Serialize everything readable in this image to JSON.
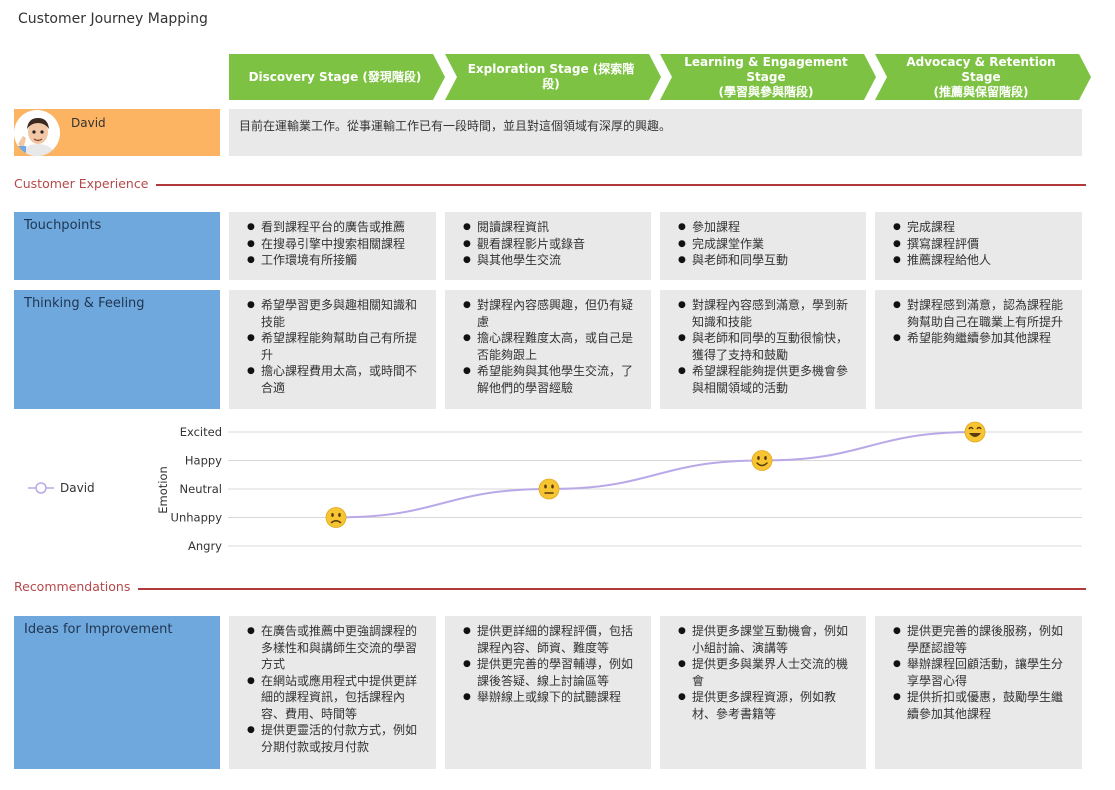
{
  "title": "Customer Journey Mapping",
  "stages": [
    {
      "line1": "Discovery Stage (發現階段)",
      "line2": ""
    },
    {
      "line1": "Exploration Stage (探索階段)",
      "line2": ""
    },
    {
      "line1": "Learning & Engagement Stage",
      "line2": "(學習與參與階段)"
    },
    {
      "line1": "Advocacy & Retention Stage",
      "line2": "(推薦與保留階段)"
    }
  ],
  "persona": {
    "name": "David",
    "description": "目前在運輸業工作。從事運輸工作已有一段時間，並且對這個領域有深厚的興趣。"
  },
  "sections": {
    "experience": "Customer Experience",
    "recommendations": "Recommendations"
  },
  "rows": {
    "touchpoints": {
      "label": "Touchpoints",
      "cells": [
        [
          "看到課程平台的廣告或推薦",
          "在搜尋引擎中搜索相關課程",
          "工作環境有所接觸"
        ],
        [
          "閱讀課程資訊",
          "觀看課程影片或錄音",
          "與其他學生交流"
        ],
        [
          "參加課程",
          "完成課堂作業",
          "與老師和同學互動"
        ],
        [
          "完成課程",
          "撰寫課程評價",
          "推薦課程給他人"
        ]
      ]
    },
    "thinking": {
      "label": "Thinking & Feeling",
      "cells": [
        [
          "希望學習更多與趣相關知識和技能",
          "希望課程能夠幫助自己有所提升",
          "擔心課程費用太高，或時間不合適"
        ],
        [
          "對課程內容感興趣，但仍有疑慮",
          "擔心課程難度太高，或自己是否能夠跟上",
          "希望能夠與其他學生交流，了解他們的學習經驗"
        ],
        [
          "對課程內容感到滿意，學到新知識和技能",
          "與老師和同學的互動很愉快，獲得了支持和鼓勵",
          "希望課程能夠提供更多機會參與相關領域的活動"
        ],
        [
          "對課程感到滿意，認為課程能夠幫助自己在職業上有所提升",
          "希望能夠繼續參加其他課程"
        ]
      ]
    },
    "ideas": {
      "label": "Ideas for Improvement",
      "cells": [
        [
          "在廣告或推薦中更強調課程的多樣性和與講師生交流的學習方式",
          "在網站或應用程式中提供更詳細的課程資訊，包括課程內容、費用、時間等",
          "提供更靈活的付款方式，例如分期付款或按月付款"
        ],
        [
          "提供更詳細的課程評價，包括課程內容、師資、難度等",
          "提供更完善的學習輔導，例如課後答疑、線上討論區等",
          "舉辦線上或線下的試聽課程"
        ],
        [
          "提供更多課堂互動機會，例如小組討論、演講等",
          "提供更多與業界人士交流的機會",
          "提供更多課程資源，例如教材、參考書籍等"
        ],
        [
          "提供更完善的課後服務，例如學歷認證等",
          "舉辦課程回顧活動，讓學生分享學習心得",
          "提供折扣或優惠，鼓勵學生繼續參加其他課程"
        ]
      ]
    }
  },
  "chart_data": {
    "type": "line",
    "ylabel": "Emotion",
    "levels": [
      "Angry",
      "Unhappy",
      "Neutral",
      "Happy",
      "Excited"
    ],
    "series": [
      {
        "name": "David",
        "values": [
          1,
          2,
          3,
          4
        ],
        "emoji": [
          "sad",
          "neutral",
          "smile",
          "grin"
        ]
      }
    ],
    "colors": {
      "line": "#b9a9e8",
      "grid": "#d8d8d8",
      "face": "#f7c531"
    }
  },
  "colors": {
    "stage": "#7dc242",
    "persona": "#fdb462",
    "row_label": "#6fa8dc",
    "cell": "#e9e9e9",
    "section_line": "#b03a3a"
  }
}
